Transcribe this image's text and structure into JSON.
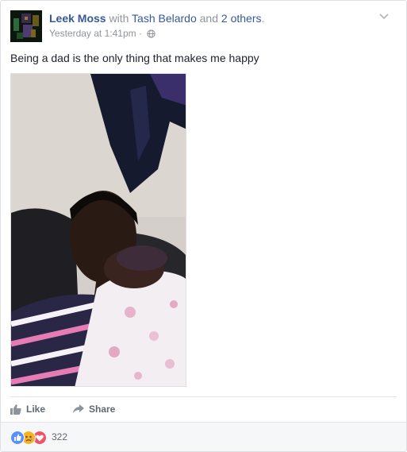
{
  "post": {
    "author": "Leek Moss",
    "with_word": "with",
    "tagged_primary": "Tash Belardo",
    "and_word": "and",
    "tagged_others": "2 others",
    "period": ".",
    "timestamp": "Yesterday at 1:41pm",
    "meta_separator": "·",
    "privacy_icon": "globe-icon",
    "text": "Being a dad is the only thing that makes me happy"
  },
  "actions": {
    "like_label": "Like",
    "share_label": "Share"
  },
  "reactions": {
    "types": [
      "like",
      "sad",
      "love"
    ],
    "colors": {
      "like": "#5890ff",
      "sad": "#f7b125",
      "love": "#f25268"
    },
    "count": "322"
  },
  "colors": {
    "link": "#365899",
    "secondary_text": "#90949c",
    "body_text": "#1d2129"
  }
}
